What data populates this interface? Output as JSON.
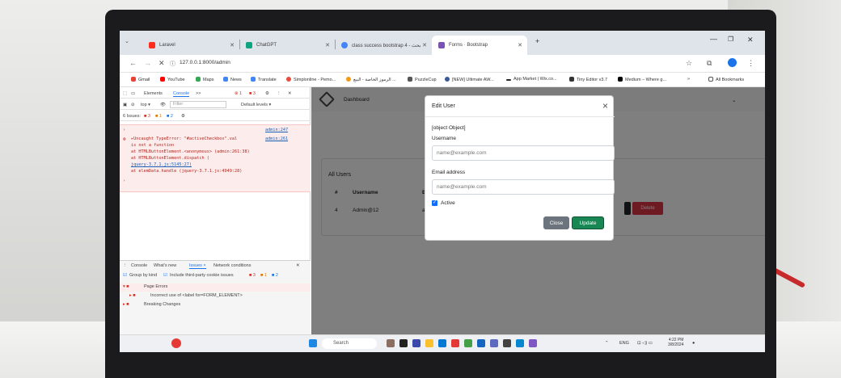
{
  "browser": {
    "tabs": [
      {
        "label": "Laravel",
        "active": false,
        "fav_color": "#ff2d20"
      },
      {
        "label": "ChatGPT",
        "active": false,
        "fav_color": "#10a37f"
      },
      {
        "label": "class success bootstrap 4 - بحث",
        "active": false,
        "fav_color": "#4285f4"
      },
      {
        "label": "Forms · Bootstrap",
        "active": true,
        "fav_color": "#7952b3"
      }
    ],
    "new_tab": "+",
    "url": "127.0.0.1:8000/admin",
    "bookmarks": [
      {
        "label": "Gmail",
        "color": "#ea4335"
      },
      {
        "label": "YouTube",
        "color": "#ff0000"
      },
      {
        "label": "Maps",
        "color": "#34a853"
      },
      {
        "label": "News",
        "color": "#4285f4"
      },
      {
        "label": "Translate",
        "color": "#4285f4"
      },
      {
        "label": "Simplonline - Pemo...",
        "color": "#e74c3c"
      },
      {
        "label": "الرموز الخاصة - البيع ...",
        "color": "#f39c12"
      },
      {
        "label": "PuzzleCup",
        "color": "#555555"
      },
      {
        "label": "[NEW] Ultimate AW...",
        "color": "#3b5998"
      },
      {
        "label": "App Market | Wix.co...",
        "color": "#222222"
      },
      {
        "label": "Tiny Editor v3.7",
        "color": "#333333"
      },
      {
        "label": "Medium – Where g...",
        "color": "#000000"
      }
    ],
    "all_bookmarks": "All Bookmarks"
  },
  "devtools": {
    "tabs": [
      "Elements",
      "Console",
      ">>"
    ],
    "active_tab": "Console",
    "error_count": "1",
    "warn_count": "3",
    "context": "top",
    "filter_placeholder": "Filter",
    "levels": "Default levels",
    "issues": "6 Issues:",
    "issue_counts": [
      "3",
      "1",
      "2"
    ],
    "error_lines": [
      "▸Uncaught TypeError: \"#activeCheckbox\".val",
      "  is not a function",
      "    at HTMLButtonElement.<anonymous> (admin:261:38)",
      "    at HTMLButtonElement.dispatch (",
      "  jquery-3.7.1.js:5145:27)",
      "    at elemData.handle (jquery-3.7.1.js:4949:28)"
    ],
    "error_links": [
      "admin:247",
      "admin:261"
    ],
    "drawer_tabs": [
      "Console",
      "What's new",
      "Issues ×",
      "Network conditions"
    ],
    "drawer_options": [
      "Group by kind",
      "Include third-party cookie issues"
    ],
    "drawer_counts": [
      "3",
      "1",
      "2"
    ],
    "drawer_items": [
      "Page Errors",
      "Incorrect use of <label for=FORM_ELEMENT>",
      "Breaking Changes"
    ]
  },
  "page": {
    "nav_link": "Dashboard",
    "card_title": "All Users",
    "table": {
      "headers": [
        "#",
        "Username",
        "E"
      ],
      "row": {
        "id": "4",
        "username": "Admin@12",
        "email": "a"
      }
    },
    "delete_label": "Delete"
  },
  "modal": {
    "title": "Edit User",
    "close_symbol": "×",
    "object_text": "[object Object]",
    "username_label": "Username",
    "username_placeholder": "name@example.com",
    "email_label": "Email address",
    "email_placeholder": "name@example.com",
    "active_label": "Active",
    "active_checked": true,
    "close_button": "Close",
    "update_button": "Update"
  },
  "taskbar": {
    "search_placeholder": "Search",
    "language": "ENG",
    "time": "4:22 PM",
    "date": "3/8/2024"
  },
  "colors": {
    "update": "#198754",
    "delete": "#dc3545",
    "close": "#6c757d",
    "checkbox": "#0d6efd"
  }
}
